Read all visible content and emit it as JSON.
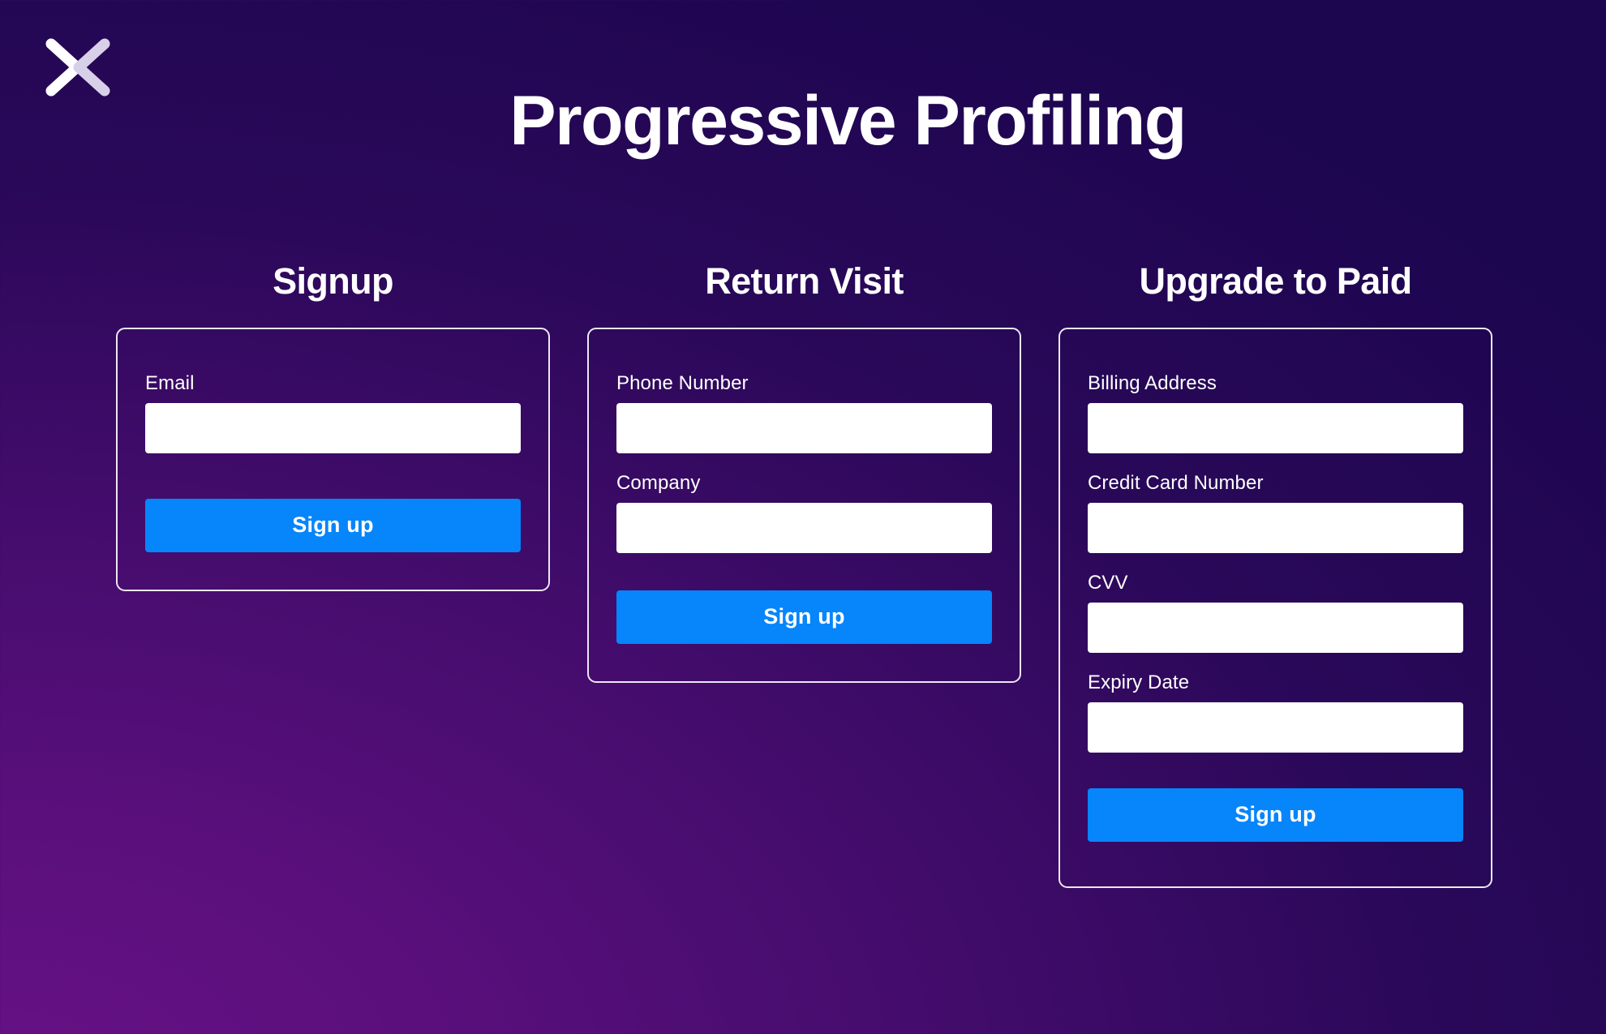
{
  "brand": {
    "logo_name": "x-chevron-logo",
    "logo_left_color": "#ffffff",
    "logo_right_color": "#d8cfe8"
  },
  "header": {
    "title": "Progressive Profiling"
  },
  "theme": {
    "background_from": "#671285",
    "background_to": "#1D0650",
    "card_border": "#ede7f3",
    "button_blue": "#0785FA",
    "input_background": "#ffffff",
    "text_color": "#ffffff"
  },
  "columns": [
    {
      "heading": "Signup",
      "fields": [
        {
          "label": "Email",
          "value": "",
          "placeholder": ""
        }
      ],
      "submit_label": "Sign up"
    },
    {
      "heading": "Return Visit",
      "fields": [
        {
          "label": "Phone Number",
          "value": "",
          "placeholder": ""
        },
        {
          "label": "Company",
          "value": "",
          "placeholder": ""
        }
      ],
      "submit_label": "Sign up"
    },
    {
      "heading": "Upgrade to Paid",
      "fields": [
        {
          "label": "Billing Address",
          "value": "",
          "placeholder": ""
        },
        {
          "label": "Credit Card Number",
          "value": "",
          "placeholder": ""
        },
        {
          "label": "CVV",
          "value": "",
          "placeholder": ""
        },
        {
          "label": "Expiry Date",
          "value": "",
          "placeholder": ""
        }
      ],
      "submit_label": "Sign up"
    }
  ]
}
